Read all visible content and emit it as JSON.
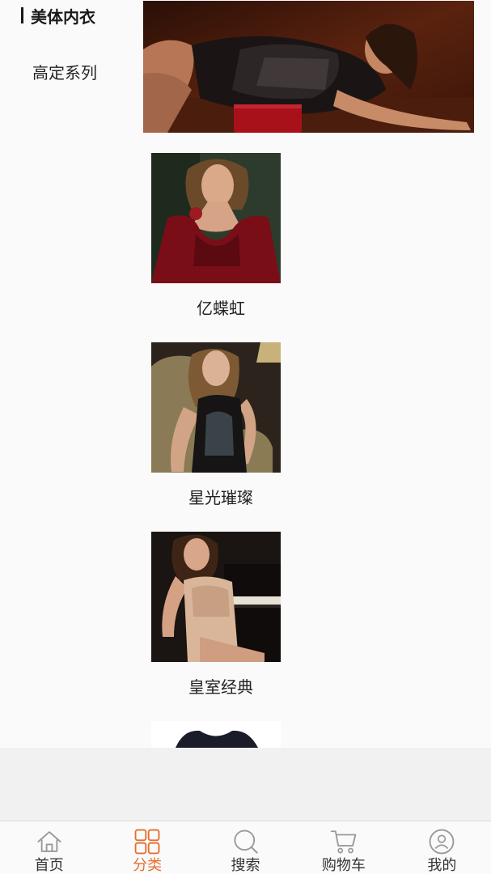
{
  "category": {
    "title": "美体内衣",
    "subcategory": "高定系列"
  },
  "products": [
    {
      "name": "亿蝶虹"
    },
    {
      "name": "星光璀璨"
    },
    {
      "name": "皇室经典"
    }
  ],
  "tabbar": {
    "tabs": [
      {
        "label": "首页",
        "icon": "home-icon"
      },
      {
        "label": "分类",
        "icon": "grid-icon",
        "active": true
      },
      {
        "label": "搜索",
        "icon": "search-icon"
      },
      {
        "label": "购物车",
        "icon": "cart-icon"
      },
      {
        "label": "我的",
        "icon": "user-icon"
      }
    ],
    "active_color": "#e86e2e",
    "inactive_color": "#999999"
  }
}
